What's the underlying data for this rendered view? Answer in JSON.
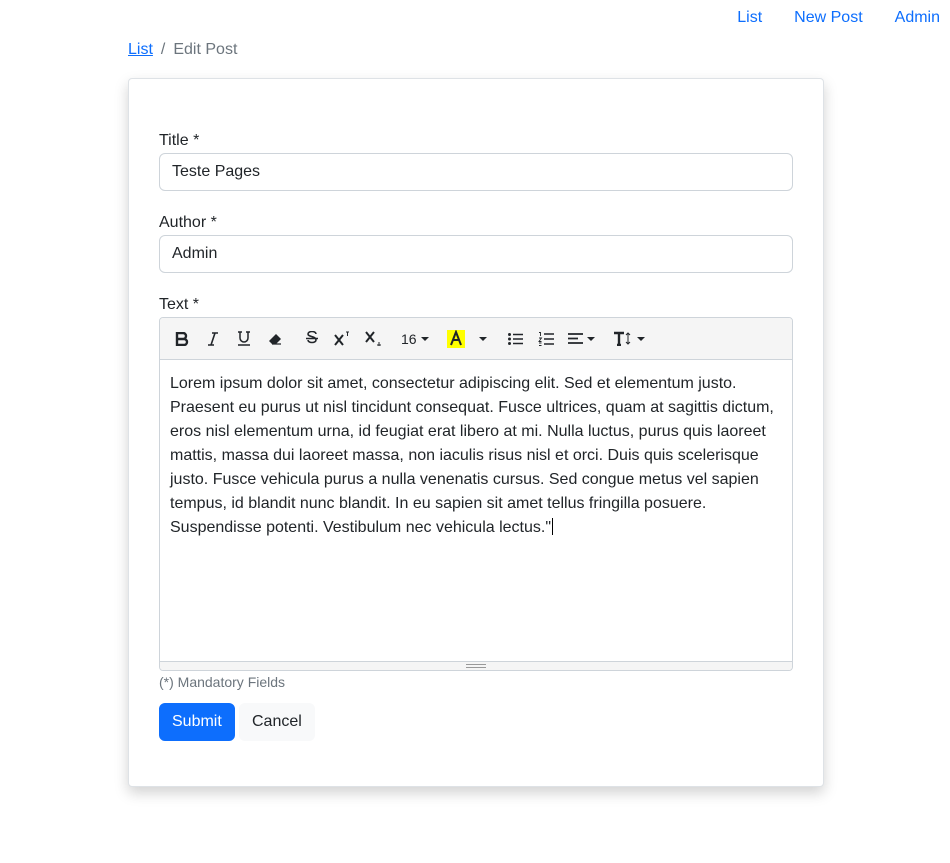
{
  "nav": {
    "items": [
      {
        "label": "List"
      },
      {
        "label": "New Post"
      },
      {
        "label": "Admin"
      }
    ]
  },
  "breadcrumb": {
    "link": "List",
    "separator": "/",
    "current": "Edit Post"
  },
  "form": {
    "title_label": "Title *",
    "title_value": "Teste Pages",
    "author_label": "Author *",
    "author_value": "Admin",
    "text_label": "Text *",
    "mandatory_hint": "(*) Mandatory Fields",
    "submit_label": "Submit",
    "cancel_label": "Cancel"
  },
  "toolbar": {
    "buttons": [
      "bold-icon",
      "italic-icon",
      "underline-icon",
      "eraser-icon",
      "strikethrough-icon",
      "superscript-icon",
      "subscript-icon",
      "font-size",
      "highlight-icon",
      "unordered-list-icon",
      "ordered-list-icon",
      "align-icon",
      "line-height-icon"
    ],
    "font_size": "16",
    "highlight_color": "#ffff00"
  },
  "editor": {
    "content": "Lorem ipsum dolor sit amet, consectetur adipiscing elit. Sed et elementum justo. Praesent eu purus ut nisl tincidunt consequat. Fusce ultrices, quam at sagittis dictum, eros nisl elementum urna, id feugiat erat libero at mi. Nulla luctus, purus quis laoreet mattis, massa dui laoreet massa, non iaculis risus nisl et orci. Duis quis scelerisque justo. Fusce vehicula purus a nulla venenatis cursus. Sed congue metus vel sapien tempus, id blandit nunc blandit. In eu sapien sit amet tellus fringilla posuere. Suspendisse potenti. Vestibulum nec vehicula lectus.\""
  }
}
